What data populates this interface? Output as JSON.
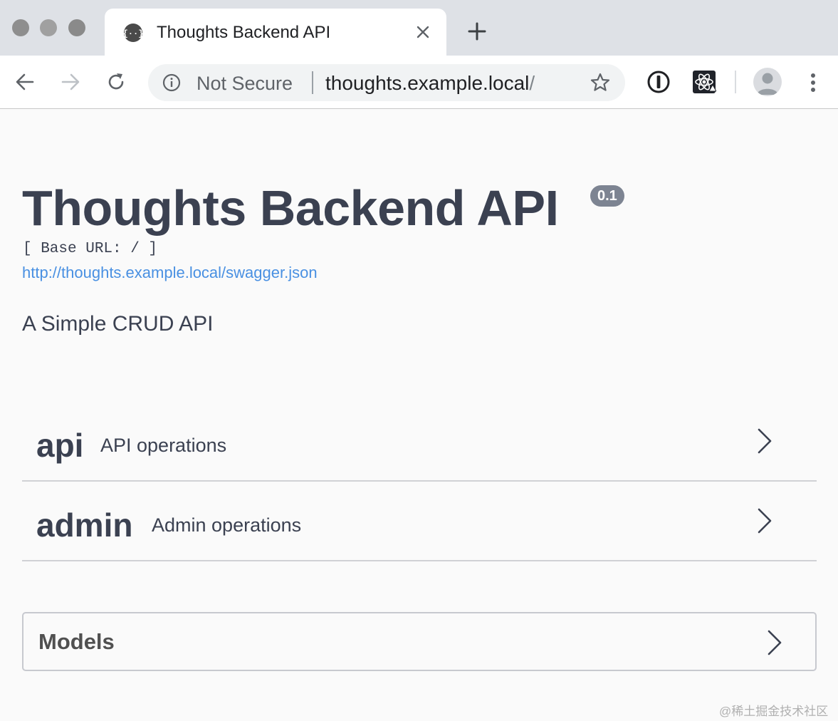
{
  "browser": {
    "tab": {
      "title": "Thoughts Backend API",
      "icon": "swagger-braces-icon"
    },
    "omnibox": {
      "security_label": "Not Secure",
      "url_main": "thoughts.example.local",
      "url_trailing": "/"
    },
    "extensions": [
      "1password-icon",
      "react-devtools-icon"
    ]
  },
  "page": {
    "title": "Thoughts Backend API",
    "version": "0.1",
    "base_url": "[ Base URL: / ]",
    "spec_link": "http://thoughts.example.local/swagger.json",
    "description": "A Simple CRUD API"
  },
  "tags": [
    {
      "name": "api",
      "description": "API operations"
    },
    {
      "name": "admin",
      "description": "Admin operations"
    }
  ],
  "models": {
    "label": "Models"
  },
  "watermark": "@稀土掘金技术社区",
  "colors": {
    "text": "#3b4151",
    "link": "#4990e2",
    "version_badge": "#7d8492",
    "divider": "#d0d1d5"
  }
}
